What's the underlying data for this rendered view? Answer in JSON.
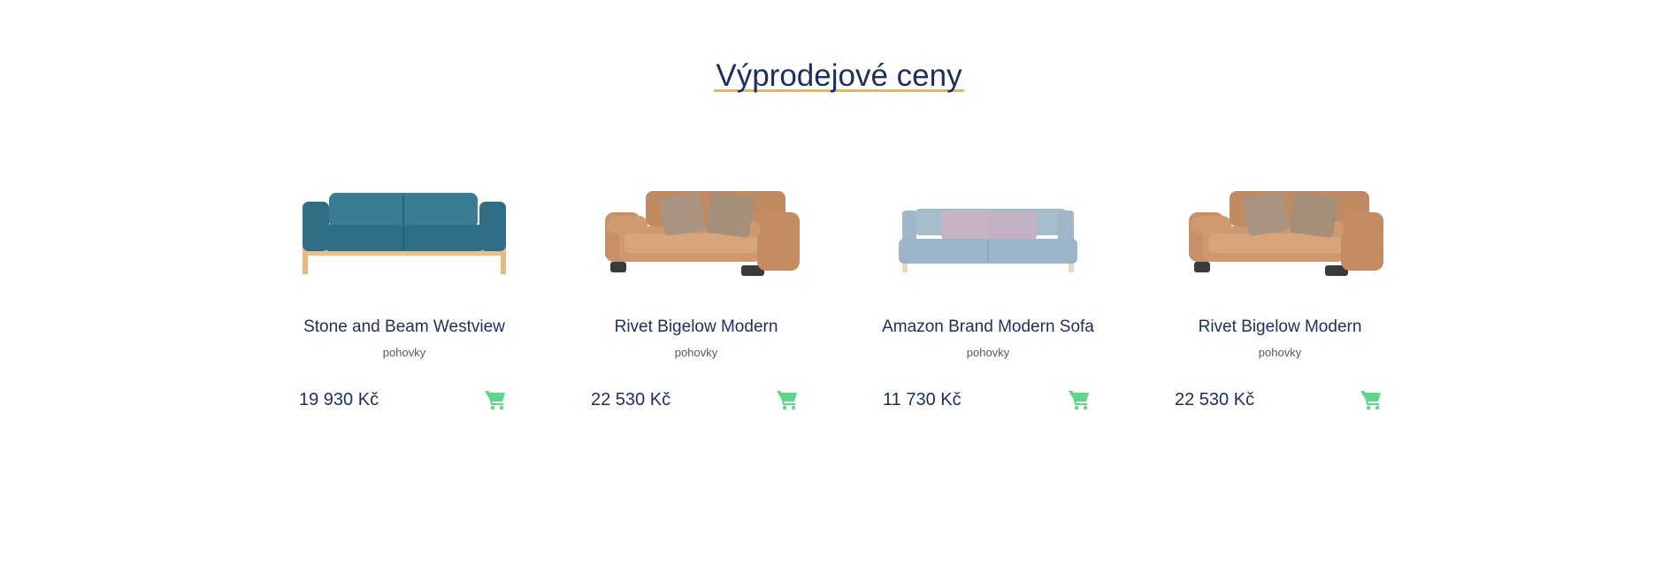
{
  "section": {
    "title": "Výprodejové ceny"
  },
  "colors": {
    "heading": "#1d2f5e",
    "underline": "#f5b928",
    "cart": "#5fd68a",
    "category_text": "#555a63"
  },
  "products": [
    {
      "name": "Stone and Beam Westview",
      "category": "pohovky",
      "price": "19 930 Kč",
      "image_icon": "teal-sofa-image",
      "cart_icon": "shopping-cart-icon"
    },
    {
      "name": "Rivet Bigelow Modern",
      "category": "pohovky",
      "price": "22 530 Kč",
      "image_icon": "tan-leather-sofa-image",
      "cart_icon": "shopping-cart-icon"
    },
    {
      "name": "Amazon Brand Modern Sofa",
      "category": "pohovky",
      "price": "11 730 Kč",
      "image_icon": "light-blue-sofa-image",
      "cart_icon": "shopping-cart-icon"
    },
    {
      "name": "Rivet Bigelow Modern",
      "category": "pohovky",
      "price": "22 530 Kč",
      "image_icon": "tan-leather-sofa-image",
      "cart_icon": "shopping-cart-icon"
    }
  ]
}
